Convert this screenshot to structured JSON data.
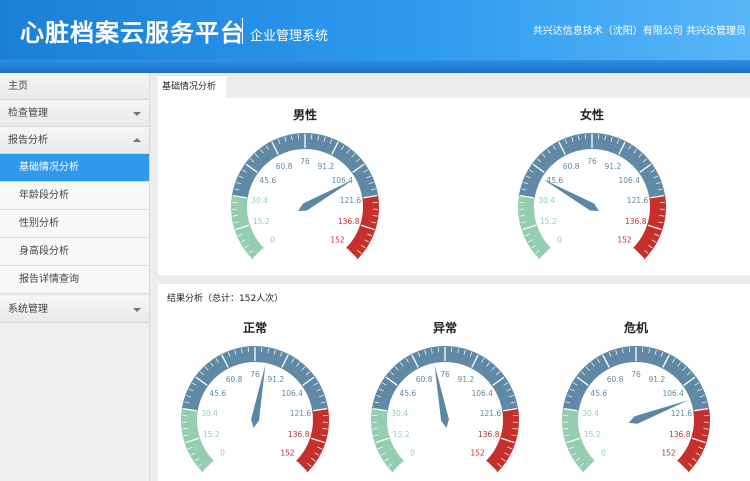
{
  "header": {
    "title": "心脏档案云服务平台",
    "subtitle": "企业管理系统",
    "company": "共兴达信息技术（沈阳）有限公司",
    "user": "共兴达管理员"
  },
  "sidebar": {
    "items": [
      {
        "label": "主页"
      },
      {
        "label": "检查管理"
      },
      {
        "label": "报告分析"
      },
      {
        "label": "系统管理"
      }
    ],
    "sub_items": [
      {
        "label": "基础情况分析",
        "active": true
      },
      {
        "label": "年龄段分析"
      },
      {
        "label": "性别分析"
      },
      {
        "label": "身高段分析"
      },
      {
        "label": "报告详情查询"
      }
    ]
  },
  "tab": {
    "label": "基础情况分析"
  },
  "result_panel": {
    "title": "结果分析（总计：152人次）"
  },
  "gauge_ticks": [
    "0",
    "15.2",
    "30.4",
    "45.6",
    "60.8",
    "76",
    "91.2",
    "106.4",
    "121.6",
    "136.8",
    "152"
  ],
  "gauge_colors": {
    "green": "#94cdb0",
    "blue": "#5f89a4",
    "red": "#c5302c",
    "needle": "#5a88a4"
  },
  "gauges": [
    {
      "title": "男性",
      "value": 110
    },
    {
      "title": "女性",
      "value": 42
    },
    {
      "title": "正常",
      "value": 82
    },
    {
      "title": "异常",
      "value": 70
    },
    {
      "title": "危机",
      "value": 115
    }
  ]
}
